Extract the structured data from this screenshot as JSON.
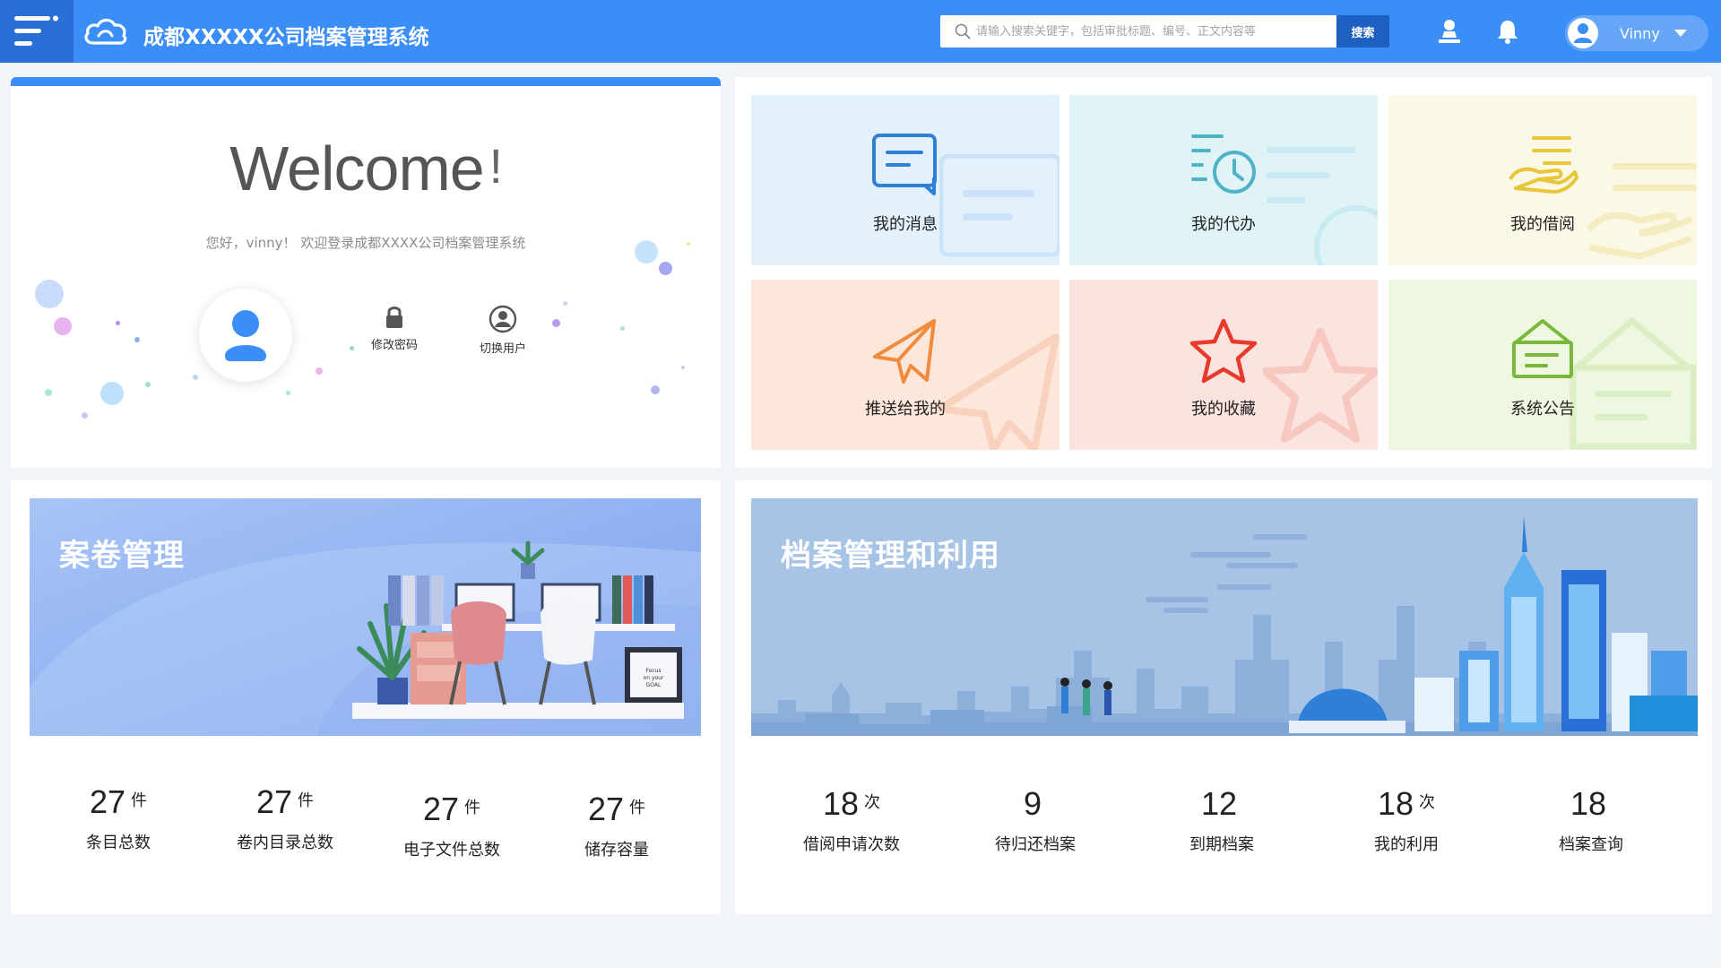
{
  "header": {
    "app_title": "成都XXXXX公司档案管理系统",
    "search_placeholder": "请输入搜索关键字，包括审批标题、编号、正文内容等",
    "search_button": "搜索",
    "user_name": "Vinny",
    "icons": [
      "menu-icon",
      "cloud-logo-icon",
      "search-icon",
      "upload-icon",
      "bell-icon",
      "user-icon",
      "caret-down-icon"
    ]
  },
  "welcome": {
    "title": "Welcome",
    "exclaim": "!",
    "subtitle": "您好，vinny！ 欢迎登录成都XXXX公司档案管理系统",
    "actions": [
      {
        "label": "修改密码",
        "icon": "lock-icon"
      },
      {
        "label": "切换用户",
        "icon": "switch-user-icon"
      }
    ]
  },
  "tiles": [
    {
      "label": "我的消息",
      "icon": "message-icon",
      "bg": "#e3f1fd",
      "color": "#2f7fd8"
    },
    {
      "label": "我的代办",
      "icon": "todo-clock-icon",
      "bg": "#e0f4f8",
      "color": "#4fb3c8"
    },
    {
      "label": "我的借阅",
      "icon": "borrow-hand-icon",
      "bg": "#fbf8e6",
      "color": "#e8c63a"
    },
    {
      "label": "推送给我的",
      "icon": "paper-plane-icon",
      "bg": "#fde7db",
      "color": "#f08a3c"
    },
    {
      "label": "我的收藏",
      "icon": "star-icon",
      "bg": "#fbe3df",
      "color": "#e8392b"
    },
    {
      "label": "系统公告",
      "icon": "notice-envelope-icon",
      "bg": "#eef7df",
      "color": "#78b83a"
    }
  ],
  "dossier": {
    "title": "案卷管理",
    "stats": [
      {
        "value": "27",
        "unit": "件",
        "label": "条目总数"
      },
      {
        "value": "27",
        "unit": "件",
        "label": "卷内目录总数"
      },
      {
        "value": "27",
        "unit": "件",
        "label": "电子文件总数"
      },
      {
        "value": "27",
        "unit": "件",
        "label": "储存容量"
      }
    ],
    "poster_text": [
      "Focus",
      "on your",
      "GOAL"
    ]
  },
  "archive": {
    "title": "档案管理和利用",
    "stats": [
      {
        "value": "18",
        "unit": "次",
        "label": "借阅申请次数"
      },
      {
        "value": "9",
        "unit": "",
        "label": "待归还档案"
      },
      {
        "value": "12",
        "unit": "",
        "label": "到期档案"
      },
      {
        "value": "18",
        "unit": "次",
        "label": "我的利用"
      },
      {
        "value": "18",
        "unit": "",
        "label": "档案查询"
      }
    ]
  }
}
